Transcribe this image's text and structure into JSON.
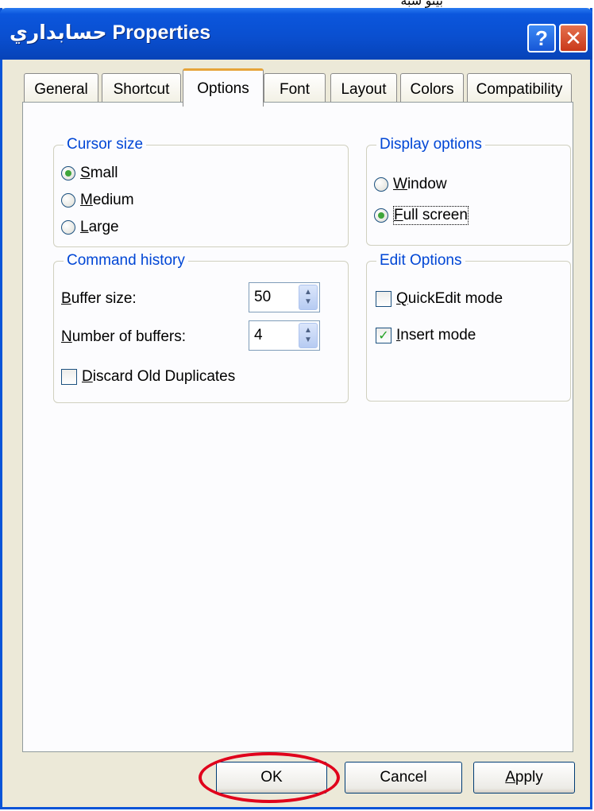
{
  "top_text": "بيتو شبه",
  "window": {
    "title": "حسابداري Properties"
  },
  "titlebar_buttons": {
    "help": "?",
    "close": "✕"
  },
  "tabs": [
    {
      "label": "General"
    },
    {
      "label": "Shortcut"
    },
    {
      "label": "Options",
      "active": true
    },
    {
      "label": "Font"
    },
    {
      "label": "Layout"
    },
    {
      "label": "Colors"
    },
    {
      "label": "Compatibility"
    }
  ],
  "cursor_size": {
    "legend": "Cursor size",
    "options": [
      {
        "label": "Small",
        "checked": true
      },
      {
        "label": "Medium",
        "checked": false
      },
      {
        "label": "Large",
        "checked": false
      }
    ]
  },
  "display_options": {
    "legend": "Display options",
    "options": [
      {
        "label": "Window",
        "checked": false
      },
      {
        "label": "Full screen",
        "checked": true
      }
    ]
  },
  "command_history": {
    "legend": "Command history",
    "buffer_size_label": "Buffer size:",
    "buffer_size_value": "50",
    "num_buffers_label": "Number of buffers:",
    "num_buffers_value": "4",
    "discard_label": "Discard Old Duplicates",
    "discard_checked": false
  },
  "edit_options": {
    "legend": "Edit Options",
    "quickedit_label": "QuickEdit mode",
    "quickedit_checked": false,
    "insert_label": "Insert mode",
    "insert_checked": true
  },
  "buttons": {
    "ok": "OK",
    "cancel": "Cancel",
    "apply": "Apply"
  },
  "colors": {
    "titlebar": "#0a4fd0",
    "legend": "#0046d5",
    "highlight_ring": "#e0001b"
  }
}
